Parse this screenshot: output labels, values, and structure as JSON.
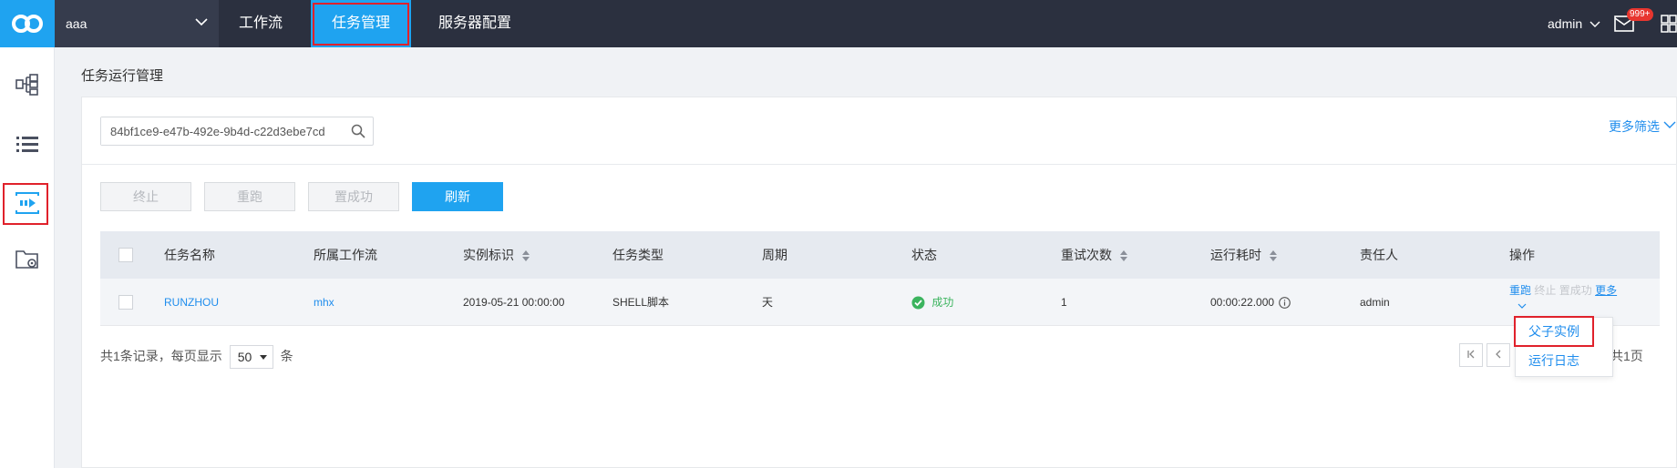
{
  "header": {
    "project": "aaa",
    "nav": [
      {
        "label": "工作流"
      },
      {
        "label": "任务管理"
      },
      {
        "label": "服务器配置"
      }
    ],
    "user": "admin",
    "badge": "999+"
  },
  "page": {
    "title": "任务运行管理",
    "search_value": "84bf1ce9-e47b-492e-9b4d-c22d3ebe7cd",
    "more_filter": "更多筛选"
  },
  "actions": {
    "stop": "终止",
    "rerun": "重跑",
    "set_success": "置成功",
    "refresh": "刷新"
  },
  "table": {
    "headers": [
      "任务名称",
      "所属工作流",
      "实例标识",
      "任务类型",
      "周期",
      "状态",
      "重试次数",
      "运行耗时",
      "责任人",
      "操作"
    ],
    "rows": [
      {
        "task_name": "RUNZHOU",
        "workflow": "mhx",
        "instance_id": "2019-05-21 00:00:00",
        "task_type": "SHELL脚本",
        "cycle": "天",
        "status": "成功",
        "retries": "1",
        "duration": "00:00:22.000",
        "owner": "admin",
        "op_rerun": "重跑",
        "op_stop": "终止",
        "op_set_success": "置成功",
        "op_more": "更多"
      }
    ]
  },
  "pagination": {
    "summary_prefix": "共1条记录，每页显示",
    "page_size": "50",
    "summary_suffix": "条",
    "total_pages": "共1页"
  },
  "more_menu": {
    "items": [
      "父子实例",
      "运行日志"
    ]
  },
  "colors": {
    "topbar": "#2b303f",
    "accent": "#1fa3f0",
    "highlight_border": "#e0212b",
    "success": "#3bb45e",
    "link": "#1f8ded"
  }
}
